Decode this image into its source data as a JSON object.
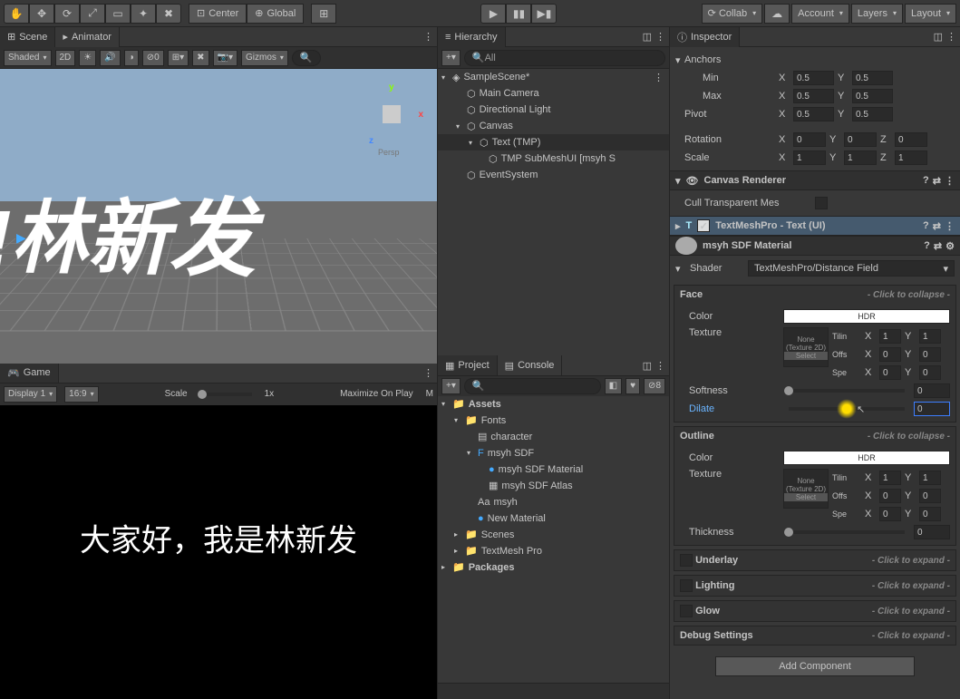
{
  "toolbar": {
    "center": "Center",
    "global": "Global",
    "collab": "Collab",
    "account": "Account",
    "layers": "Layers",
    "layout": "Layout"
  },
  "scene": {
    "tabScene": "Scene",
    "tabAnimator": "Animator",
    "shaded": "Shaded",
    "mode2d": "2D",
    "gizmos": "Gizmos",
    "persp": "Persp",
    "text": "!林新发",
    "axisX": "x",
    "axisY": "y",
    "axisZ": "z"
  },
  "game": {
    "tab": "Game",
    "display": "Display 1",
    "aspect": "16:9",
    "scale": "Scale",
    "scaleVal": "1x",
    "maximize": "Maximize On Play",
    "text": "大家好，我是林新发"
  },
  "hierarchy": {
    "tab": "Hierarchy",
    "searchAll": "All",
    "items": [
      "SampleScene*",
      "Main Camera",
      "Directional Light",
      "Canvas",
      "Text (TMP)",
      "TMP SubMeshUI [msyh S",
      "EventSystem"
    ]
  },
  "project": {
    "tabProject": "Project",
    "tabConsole": "Console",
    "count": "8",
    "items": [
      "Assets",
      "Fonts",
      "character",
      "msyh SDF",
      "msyh SDF Material",
      "msyh SDF Atlas",
      "msyh",
      "New Material",
      "Scenes",
      "TextMesh Pro",
      "Packages"
    ]
  },
  "inspector": {
    "tab": "Inspector",
    "anchors": "Anchors",
    "min": "Min",
    "max": "Max",
    "pivot": "Pivot",
    "rotation": "Rotation",
    "scaleL": "Scale",
    "minX": "0.5",
    "minY": "0.5",
    "maxX": "0.5",
    "maxY": "0.5",
    "pivX": "0.5",
    "pivY": "0.5",
    "rotX": "0",
    "rotY": "0",
    "rotZ": "0",
    "sclX": "1",
    "sclY": "1",
    "sclZ": "1",
    "canvasRenderer": "Canvas Renderer",
    "cullMesh": "Cull Transparent Mes",
    "tmp": "TextMeshPro - Text (UI)",
    "material": "msyh SDF Material",
    "shaderL": "Shader",
    "shaderV": "TextMeshPro/Distance Field",
    "face": "Face",
    "outline": "Outline",
    "color": "Color",
    "texture": "Texture",
    "hdr": "HDR",
    "noneTex": "None (Texture 2D)",
    "select": "Select",
    "tiling": "Tilin",
    "offset": "Offs",
    "speed": "Spe",
    "softness": "Softness",
    "dilate": "Dilate",
    "thickness": "Thickness",
    "underlay": "Underlay",
    "lighting": "Lighting",
    "glow": "Glow",
    "debug": "Debug Settings",
    "collapse": "- Click to collapse -",
    "expand": "- Click to expand -",
    "addComp": "Add Component",
    "x": "X",
    "y": "Y",
    "z": "Z",
    "one": "1",
    "zero": "0",
    "softVal": "0",
    "dilateVal": "0",
    "thickVal": "0"
  }
}
